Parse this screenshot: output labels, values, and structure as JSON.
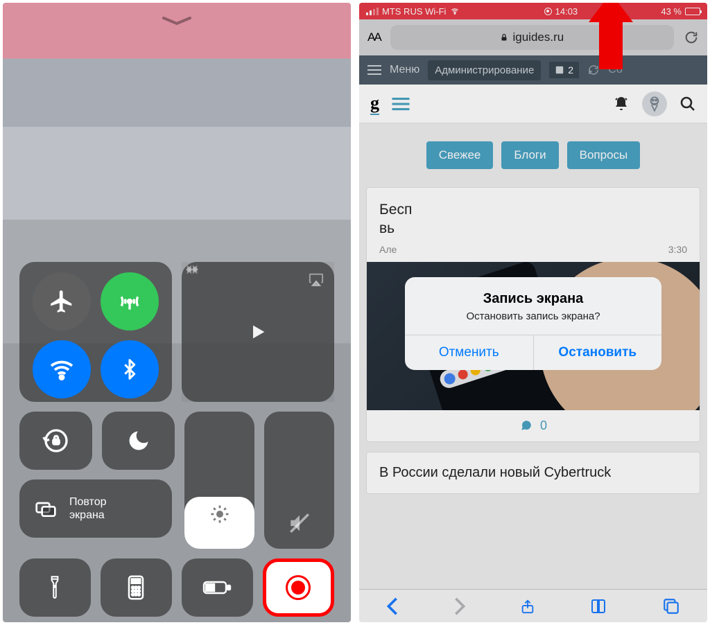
{
  "left": {
    "screen_mirror_label": "Повтор\nэкрана"
  },
  "right": {
    "status": {
      "carrier": "MTS RUS Wi-Fi",
      "time": "14:03",
      "battery_pct": "43 %",
      "battery_fill": 43
    },
    "url": {
      "text_size": "AA",
      "domain": "iguides.ru"
    },
    "admin": {
      "menu": "Меню",
      "button": "Администрирование",
      "badge": "2",
      "refresh": "Сб"
    },
    "pills": [
      "Свежее",
      "Блоги",
      "Вопросы"
    ],
    "article1": {
      "title_partial": "Бесп",
      "title_partial2": "вь",
      "author_abbr": "Але",
      "time": "3:30",
      "comments": "0"
    },
    "article2": {
      "title": "В России сделали новый Cybertruck"
    },
    "alert": {
      "title": "Запись экрана",
      "message": "Остановить запись экрана?",
      "cancel": "Отменить",
      "stop": "Остановить"
    }
  }
}
